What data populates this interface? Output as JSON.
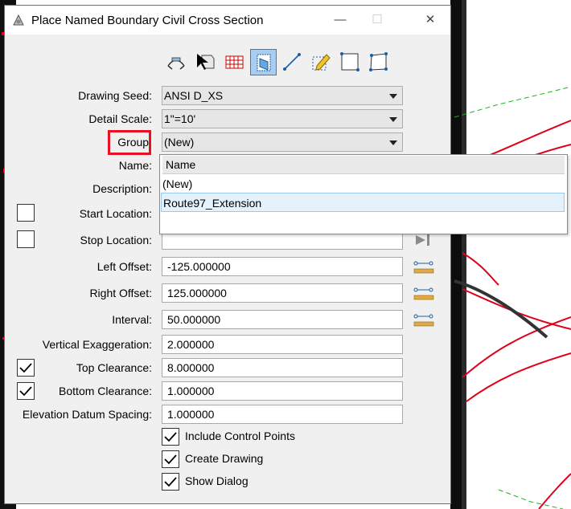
{
  "window": {
    "title": "Place Named Boundary Civil Cross Section",
    "minimize_glyph": "—",
    "maximize_glyph": "☐",
    "close_glyph": "✕"
  },
  "toolbar": {
    "tools": [
      {
        "name": "civil-arc-tool-icon",
        "selected": false
      },
      {
        "name": "cursor-box-tool-icon",
        "selected": false
      },
      {
        "name": "grid-tool-icon",
        "selected": false
      },
      {
        "name": "cross-section-tool-icon",
        "selected": true
      },
      {
        "name": "line-tool-icon",
        "selected": false
      },
      {
        "name": "pencil-tool-icon",
        "selected": false
      },
      {
        "name": "rectangle-tool-icon",
        "selected": false
      },
      {
        "name": "polygon-tool-icon",
        "selected": false
      }
    ]
  },
  "form": {
    "drawing_seed_label": "Drawing Seed:",
    "drawing_seed_value": "ANSI D_XS",
    "detail_scale_label": "Detail Scale:",
    "detail_scale_value": "1\"=10'",
    "group_label": "Group:",
    "group_value": "(New)",
    "name_label": "Name:",
    "description_label": "Description:",
    "start_location_label": "Start Location:",
    "stop_location_label": "Stop Location:",
    "left_offset_label": "Left Offset:",
    "left_offset_value": "-125.000000",
    "right_offset_label": "Right Offset:",
    "right_offset_value": "125.000000",
    "interval_label": "Interval:",
    "interval_value": "50.000000",
    "vertical_exaggeration_label": "Vertical Exaggeration:",
    "vertical_exaggeration_value": "2.000000",
    "top_clearance_label": "Top Clearance:",
    "top_clearance_value": "8.000000",
    "top_clearance_checked": true,
    "bottom_clearance_label": "Bottom Clearance:",
    "bottom_clearance_value": "1.000000",
    "bottom_clearance_checked": true,
    "elevation_datum_label": "Elevation Datum Spacing:",
    "elevation_datum_value": "1.000000",
    "start_location_checked": false,
    "stop_location_checked": false
  },
  "options": {
    "include_control_points": "Include Control Points",
    "include_control_points_checked": true,
    "create_drawing": "Create Drawing",
    "create_drawing_checked": true,
    "show_dialog": "Show Dialog",
    "show_dialog_checked": true
  },
  "group_dropdown": {
    "header": "Name",
    "items": [
      "(New)",
      "Route97_Extension"
    ],
    "selected_index": 1
  },
  "colors": {
    "accent_highlight": "#e81123",
    "selected_tool": "#a9cdf0",
    "cad_red": "#e0001a",
    "cad_green": "#1db31d"
  }
}
